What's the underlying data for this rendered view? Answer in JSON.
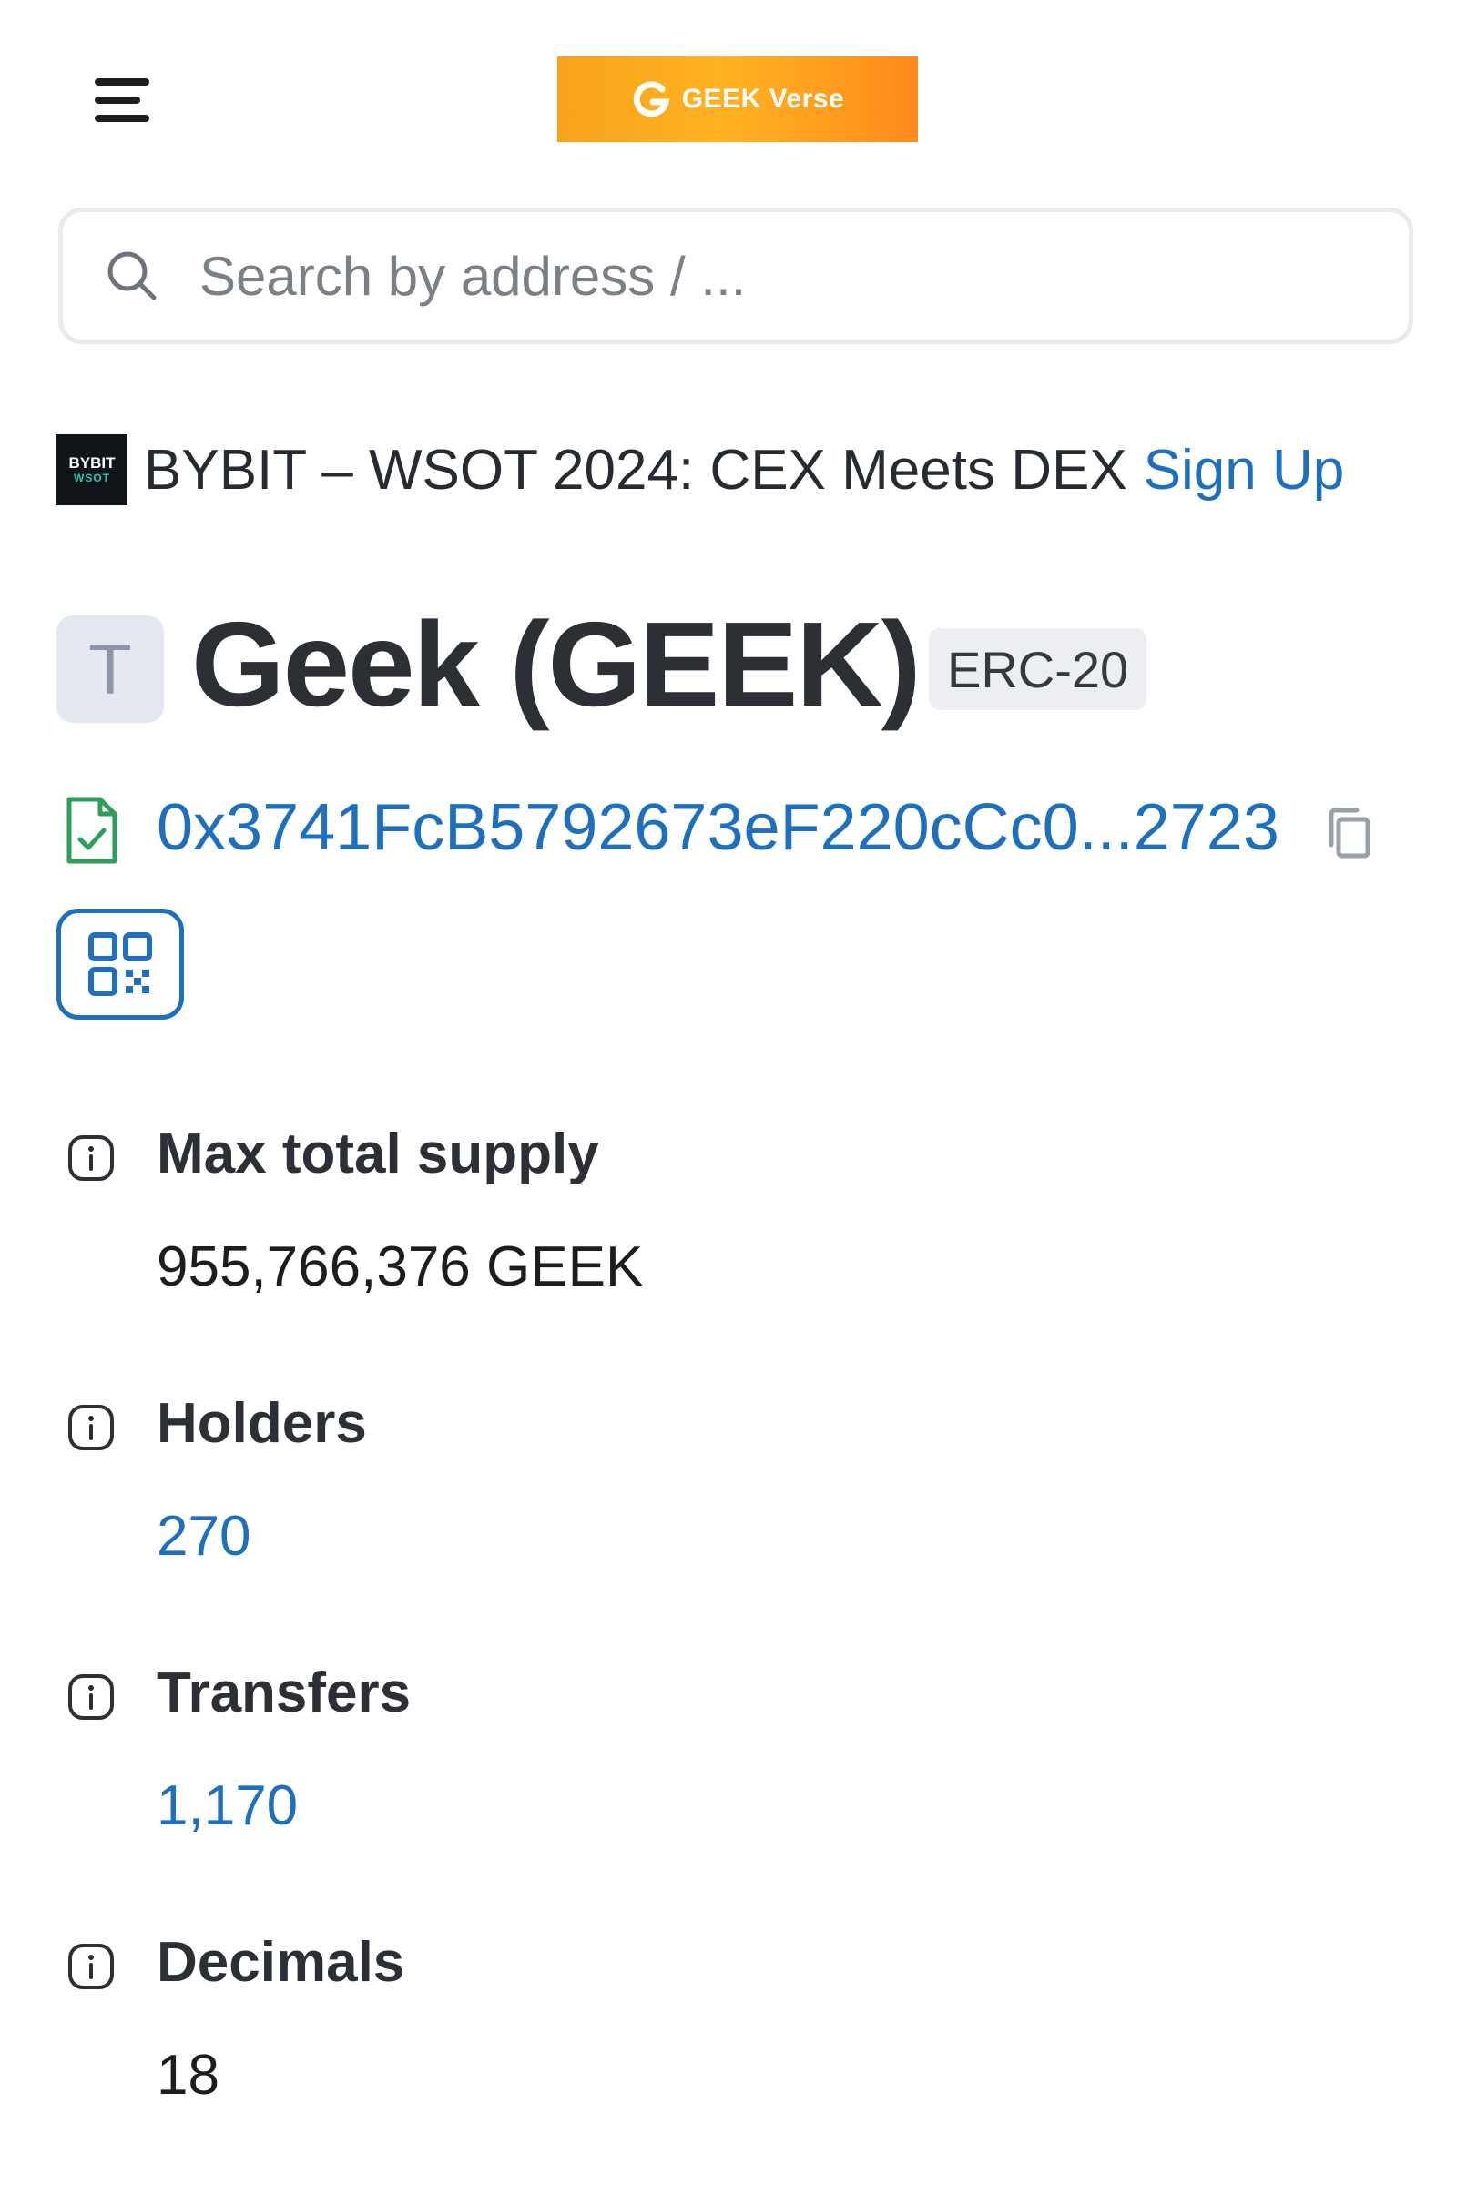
{
  "header": {
    "menu_icon": "hamburger-menu-icon",
    "banner": {
      "brand": "GEEK Verse",
      "icon": "geek-logo-icon"
    }
  },
  "search": {
    "placeholder": "Search by address / ..."
  },
  "promo": {
    "logo_top": "BYBIT",
    "logo_bottom": "WSOT",
    "text": "BYBIT – WSOT 2024: CEX Meets DEX",
    "link": "Sign Up"
  },
  "token": {
    "avatar_letter": "T",
    "name": "Geek (GEEK)",
    "standard": "ERC-20",
    "address": "0x3741FcB5792673eF220cCc0...2723"
  },
  "stats": [
    {
      "label": "Max total supply",
      "value": "955,766,376 GEEK"
    },
    {
      "label": "Holders",
      "value": "270"
    },
    {
      "label": "Transfers",
      "value": "1,170"
    },
    {
      "label": "Decimals",
      "value": "18"
    }
  ],
  "colors": {
    "link": "#1f6fbf",
    "banner_orange": "#ffb321",
    "contract_icon_green": "#2e9e5b"
  }
}
